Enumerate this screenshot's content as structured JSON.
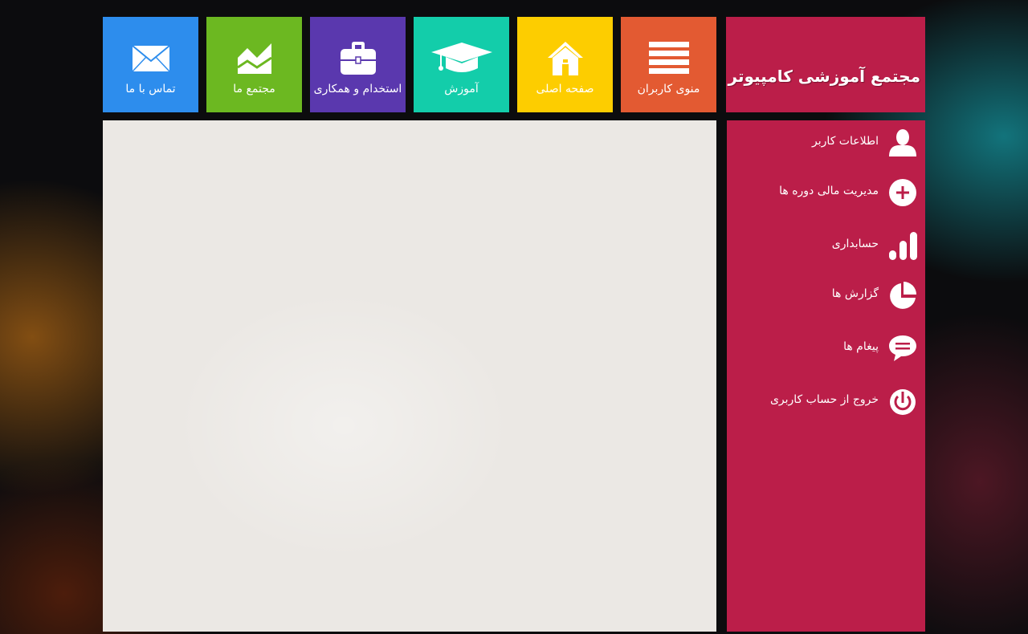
{
  "brand": {
    "title": "مجتمع آموزشی کامپیوتر"
  },
  "tiles": [
    {
      "label": "منوی کاربران",
      "icon": "menu-lines-icon",
      "color": "#e35a32"
    },
    {
      "label": "صفحه اصلی",
      "icon": "home-icon",
      "color": "#fdcd00"
    },
    {
      "label": "آموزش",
      "icon": "graduation-cap-icon",
      "color": "#13cdaa"
    },
    {
      "label": "استخدام و همکاری",
      "icon": "briefcase-icon",
      "color": "#5a38ae"
    },
    {
      "label": "مجتمع ما",
      "icon": "area-chart-icon",
      "color": "#6cb821"
    },
    {
      "label": "تماس با ما",
      "icon": "envelope-icon",
      "color": "#2d8ded"
    }
  ],
  "sidebar": {
    "color": "#bb1e49",
    "items": [
      {
        "label": "اطلاعات کاربر",
        "icon": "user-icon"
      },
      {
        "label": "مدیریت مالی دوره ها",
        "icon": "plus-circle-icon"
      },
      {
        "label": "حسابداری",
        "icon": "bar-chart-icon"
      },
      {
        "label": "گزارش ها",
        "icon": "pie-chart-icon"
      },
      {
        "label": "پیغام ها",
        "icon": "chat-bubble-icon"
      },
      {
        "label": "خروج از حساب کاربری",
        "icon": "power-icon"
      }
    ]
  }
}
